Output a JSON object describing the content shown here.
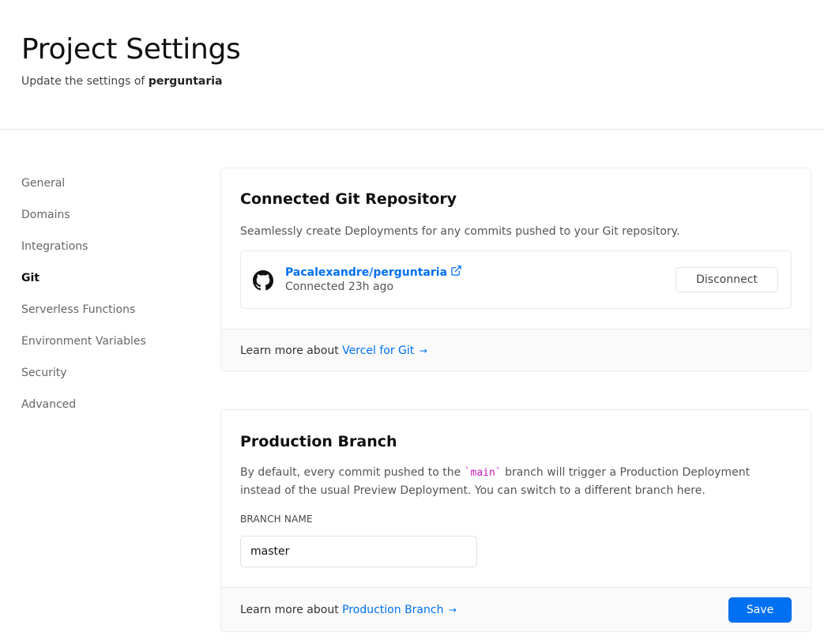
{
  "header": {
    "title": "Project Settings",
    "subtitle_prefix": "Update the settings of",
    "project_name": "perguntaria"
  },
  "sidebar": {
    "items": [
      {
        "label": "General"
      },
      {
        "label": "Domains"
      },
      {
        "label": "Integrations"
      },
      {
        "label": "Git",
        "active": true
      },
      {
        "label": "Serverless Functions"
      },
      {
        "label": "Environment Variables"
      },
      {
        "label": "Security"
      },
      {
        "label": "Advanced"
      }
    ]
  },
  "git_card": {
    "title": "Connected Git Repository",
    "description": "Seamlessly create Deployments for any commits pushed to your Git repository.",
    "repo_name": "Pacalexandre/perguntaria",
    "repo_status": "Connected 23h ago",
    "repo_icon": "github-icon",
    "disconnect_label": "Disconnect",
    "footer_prefix": "Learn more about",
    "footer_link": "Vercel for Git",
    "footer_arrow": "→"
  },
  "branch_card": {
    "title": "Production Branch",
    "description_before": "By default, every commit pushed to the",
    "branch_code": "`main`",
    "description_after": "branch will trigger a Production Deployment instead of the usual Preview Deployment. You can switch to a different branch here.",
    "field_label": "BRANCH NAME",
    "branch_value": "master",
    "footer_prefix": "Learn more about",
    "footer_link": "Production Branch",
    "footer_arrow": "→",
    "save_label": "Save"
  },
  "colors": {
    "accent": "#0070f3",
    "code": "#c41ab8",
    "border": "#eaeaea",
    "footer_bg": "#fafafa"
  }
}
